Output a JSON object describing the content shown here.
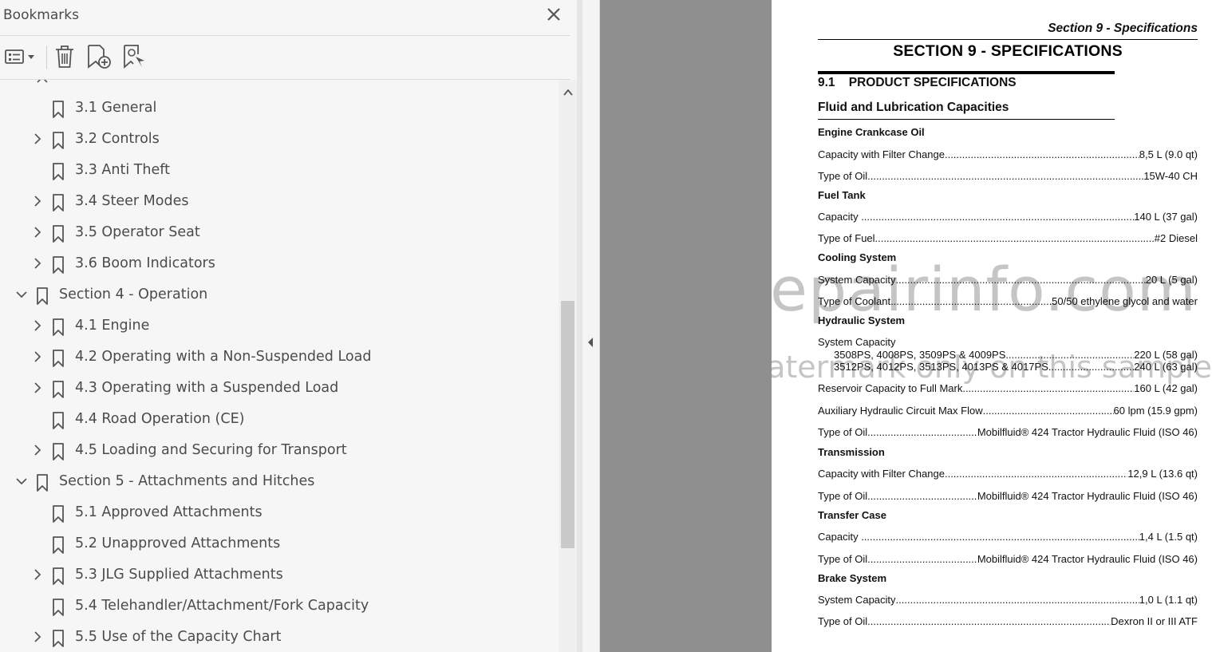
{
  "bookmarks": {
    "title": "Bookmarks",
    "items": [
      {
        "label": "3.1 General",
        "level": 2,
        "expandable": false
      },
      {
        "label": "3.2 Controls",
        "level": 2,
        "expandable": true
      },
      {
        "label": "3.3 Anti Theft",
        "level": 2,
        "expandable": false
      },
      {
        "label": "3.4 Steer Modes",
        "level": 2,
        "expandable": true
      },
      {
        "label": "3.5 Operator Seat",
        "level": 2,
        "expandable": true
      },
      {
        "label": "3.6 Boom Indicators",
        "level": 2,
        "expandable": true
      },
      {
        "label": "Section 4 - Operation",
        "level": 1,
        "expanded": true
      },
      {
        "label": "4.1 Engine",
        "level": 2,
        "expandable": true
      },
      {
        "label": "4.2 Operating with a Non-Suspended Load",
        "level": 2,
        "expandable": true
      },
      {
        "label": "4.3 Operating with a Suspended Load",
        "level": 2,
        "expandable": true
      },
      {
        "label": "4.4 Road Operation (CE)",
        "level": 2,
        "expandable": false
      },
      {
        "label": "4.5 Loading and Securing for Transport",
        "level": 2,
        "expandable": true
      },
      {
        "label": "Section 5 - Attachments and Hitches",
        "level": 1,
        "expanded": true
      },
      {
        "label": "5.1 Approved Attachments",
        "level": 2,
        "expandable": false
      },
      {
        "label": "5.2 Unapproved Attachments",
        "level": 2,
        "expandable": false
      },
      {
        "label": "5.3 JLG Supplied Attachments",
        "level": 2,
        "expandable": true
      },
      {
        "label": "5.4 Telehandler/Attachment/Fork Capacity",
        "level": 2,
        "expandable": false
      },
      {
        "label": "5.5 Use of the Capacity Chart",
        "level": 2,
        "expandable": true
      }
    ]
  },
  "document": {
    "header": "Section 9 - Specifications",
    "title": "SECTION 9 - SPECIFICATIONS",
    "section": "9.1    PRODUCT SPECIFICATIONS",
    "subsection": "Fluid and Lubrication Capacities",
    "groups": [
      {
        "name": "Engine Crankcase Oil",
        "lines": [
          {
            "label": "Capacity with Filter Change",
            "value": "8,5 L (9.0 qt)"
          },
          {
            "label": "Type of Oil",
            "value": "15W-40 CH"
          }
        ]
      },
      {
        "name": "Fuel Tank",
        "lines": [
          {
            "label": "Capacity ..",
            "value": "140 L (37 gal)"
          },
          {
            "label": "Type of Fuel",
            "value": "#2 Diesel"
          }
        ]
      },
      {
        "name": "Cooling System",
        "lines": [
          {
            "label": "System Capacity",
            "value": "20 L (5 gal)"
          },
          {
            "label": "Type of Coolant",
            "value": "50/50 ethylene glycol and water"
          }
        ]
      },
      {
        "name": "Hydraulic System",
        "lines": [
          {
            "label": "System Capacity",
            "value": ""
          },
          {
            "label": "3508PS, 4008PS, 3509PS & 4009PS",
            "value": "220 L (58 gal)"
          },
          {
            "label": "3512PS, 4012PS, 3513PS, 4013PS & 4017PS",
            "value": "240 L (63 gal)"
          },
          {
            "label": "Reservoir Capacity to Full Mark",
            "value": "160 L (42 gal)"
          },
          {
            "label": "Auxiliary Hydraulic Circuit Max Flow",
            "value": "60 lpm (15.9 gpm)"
          },
          {
            "label": "Type of Oil",
            "value": "Mobilfluid® 424 Tractor Hydraulic Fluid (ISO 46)"
          }
        ]
      },
      {
        "name": "Transmission",
        "lines": [
          {
            "label": "Capacity with Filter Change",
            "value": "12,9 L (13.6 qt)"
          },
          {
            "label": "Type of Oil",
            "value": "Mobilfluid® 424 Tractor Hydraulic Fluid (ISO 46)"
          }
        ]
      },
      {
        "name": "Transfer Case",
        "lines": [
          {
            "label": "Capacity ..",
            "value": "1,4 L (1.5 qt)"
          },
          {
            "label": "Type of Oil",
            "value": "Mobilfluid® 424 Tractor Hydraulic Fluid (ISO 46)"
          }
        ]
      },
      {
        "name": "Brake System",
        "lines": [
          {
            "label": "System Capacity",
            "value": "1,0 L (1.1 qt)"
          },
          {
            "label": "Type of Oil",
            "value": "Dexron II or III ATF"
          }
        ]
      }
    ],
    "watermark_main": "eRepairinfo.com",
    "watermark_sub": "watermark only on this sample"
  }
}
